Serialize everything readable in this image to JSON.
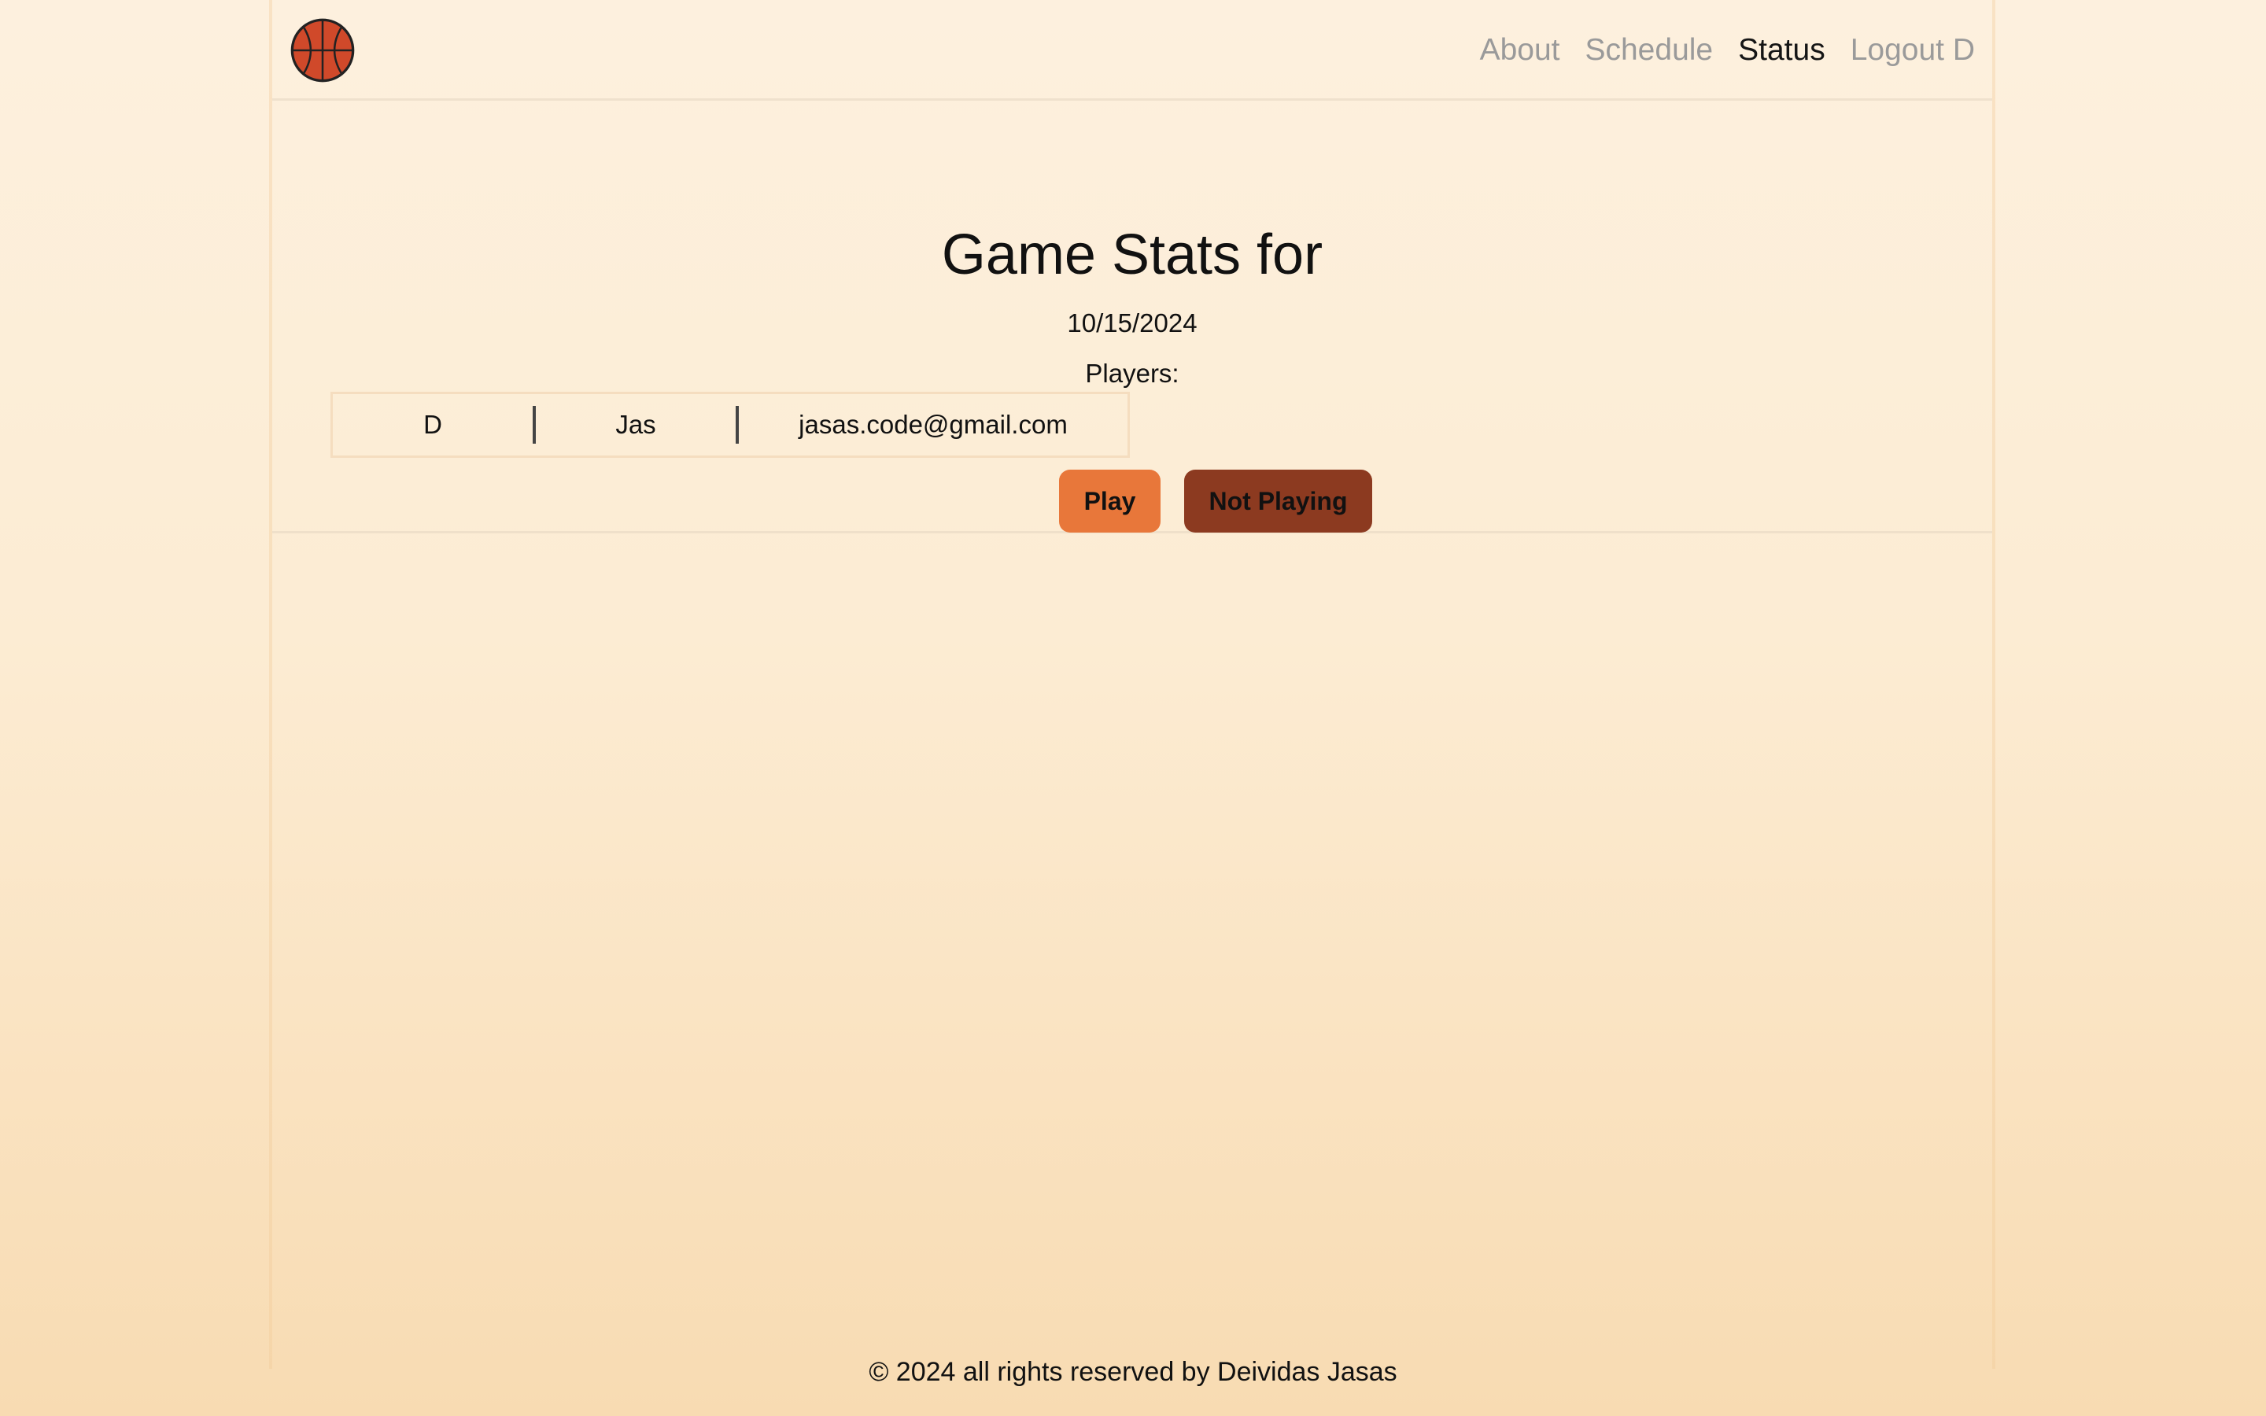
{
  "nav": {
    "logo": "basketball-icon",
    "links": [
      "About",
      "Schedule",
      "Status",
      "Logout D"
    ],
    "active": "Status"
  },
  "main": {
    "title": "Game Stats for",
    "date": "10/15/2024",
    "players_label": "Players:",
    "players": [
      {
        "first_name": "D",
        "last_name": "Jas",
        "email": "jasas.code@gmail.com"
      }
    ],
    "buttons": {
      "play": "Play",
      "not_playing": "Not Playing"
    }
  },
  "footer": {
    "text": "© 2024 all rights reserved by Deividas Jasas"
  },
  "colors": {
    "play_button": "#e8773a",
    "not_playing_button": "#8c3a20",
    "nav_inactive": "#9a9a9a",
    "nav_active": "#151515",
    "ball": "#d0492a"
  }
}
